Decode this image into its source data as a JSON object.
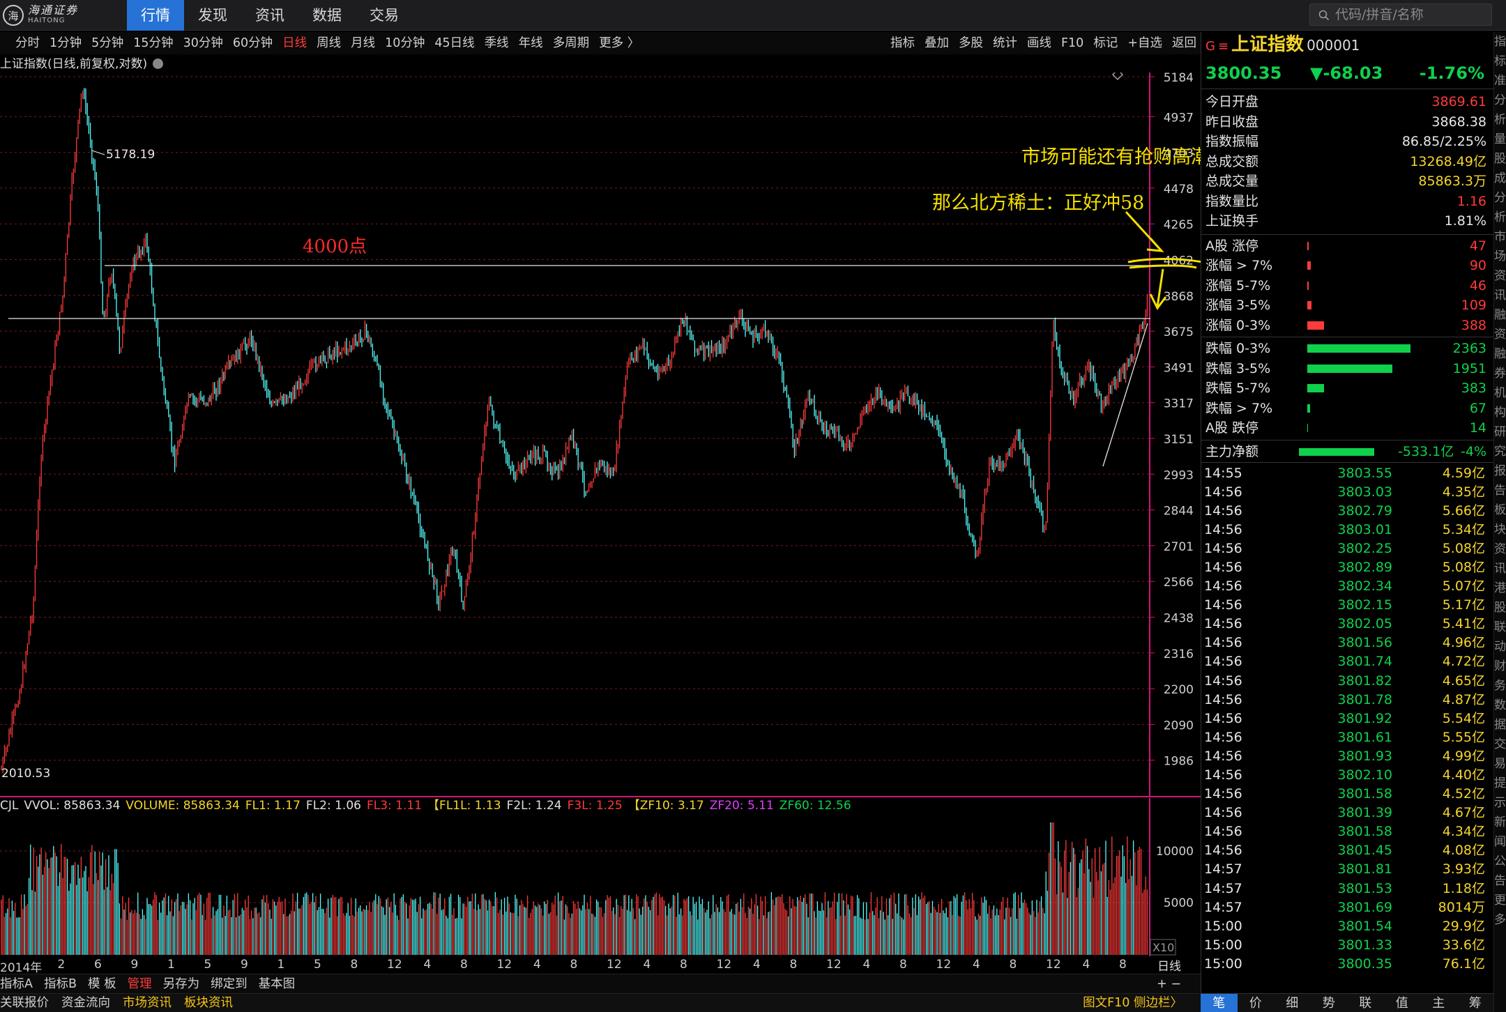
{
  "app": {
    "logo_cn": "海通证券",
    "logo_en": "HAITONG",
    "logo_mark": "海"
  },
  "nav": [
    {
      "label": "行情",
      "active": true
    },
    {
      "label": "发现"
    },
    {
      "label": "资讯"
    },
    {
      "label": "数据"
    },
    {
      "label": "交易"
    }
  ],
  "search": {
    "placeholder": "代码/拼音/名称"
  },
  "periods": [
    "分时",
    "1分钟",
    "5分钟",
    "15分钟",
    "30分钟",
    "60分钟",
    "日线",
    "周线",
    "月线",
    "10分钟",
    "45日线",
    "季线",
    "年线",
    "多周期",
    "更多 〉"
  ],
  "period_active": "日线",
  "tools": [
    "指标",
    "叠加",
    "多股",
    "统计",
    "画线",
    "F10",
    "标记",
    "+自选",
    "返回"
  ],
  "chart": {
    "title": "上证指数(日线,前复权,对数)",
    "y_ticks": [
      "5184",
      "4937",
      "4703",
      "4478",
      "4265",
      "4062",
      "3868",
      "3675",
      "3491",
      "3317",
      "3151",
      "2993",
      "2844",
      "2701",
      "2566",
      "2438",
      "2316",
      "2200",
      "2090",
      "1986"
    ],
    "high_label": "5178.19",
    "low_label": "2010.53",
    "annotation_4000": "4000点",
    "annotation_1": "市场可能还有抢购高潮",
    "annotation_2": "那么北方稀土：正好冲58",
    "colors": {
      "up": "#ff3b3b",
      "down": "#54ffff",
      "grid": "#7a1a1a",
      "annot_red": "#ff2a2a",
      "annot_yellow": "#f5e000"
    }
  },
  "volume": {
    "indicators": [
      {
        "text": "CJL",
        "color": "#e0e0e0"
      },
      {
        "text": "VVOL: 85863.34",
        "color": "#e0e0e0"
      },
      {
        "text": "VOLUME: 85863.34",
        "color": "#f5d52b"
      },
      {
        "text": "FL1: 1.17",
        "color": "#f5d52b"
      },
      {
        "text": "FL2: 1.06",
        "color": "#e0e0e0"
      },
      {
        "text": "FL3: 1.11",
        "color": "#ff3b3b"
      },
      {
        "text": "【FL1L: 1.13",
        "color": "#f5d52b"
      },
      {
        "text": "F2L: 1.24",
        "color": "#e0e0e0"
      },
      {
        "text": "F3L: 1.25",
        "color": "#ff3b3b"
      },
      {
        "text": "【ZF10: 3.17",
        "color": "#f5d52b"
      },
      {
        "text": "ZF20: 5.11",
        "color": "#e040fb"
      },
      {
        "text": "ZF60: 12.56",
        "color": "#0fd14c"
      }
    ],
    "y_ticks": [
      "10000",
      "5000"
    ],
    "unit_label": "X10"
  },
  "xaxis": [
    "2014年",
    "2",
    "6",
    "9",
    "1",
    "5",
    "9",
    "1",
    "5",
    "8",
    "12",
    "4",
    "8",
    "12",
    "4",
    "8",
    "12",
    "4",
    "8",
    "12",
    "4",
    "8",
    "12",
    "4",
    "8",
    "12",
    "4",
    "8",
    "12",
    "4",
    "8"
  ],
  "xaxis_tab": "日线",
  "bottom_tabs": [
    "指标A",
    "指标B",
    "模 板",
    "管理",
    "另存为",
    "绑定到",
    "基本图"
  ],
  "bottom_tab_active": "管理",
  "bottom_plusminus": "+  −",
  "bottom_links": [
    {
      "label": "关联报价",
      "hl": false
    },
    {
      "label": "资金流向",
      "hl": false
    },
    {
      "label": "市场资讯",
      "hl": true
    },
    {
      "label": "板块资讯",
      "hl": true
    }
  ],
  "bottom_right": "图文F10  侧边栏〉",
  "quote": {
    "g": "G",
    "eq": "≡",
    "name": "上证指数",
    "code": "000001",
    "price": "3800.35",
    "change": "▼-68.03",
    "pct": "-1.76%"
  },
  "stats": [
    {
      "k": "今日开盘",
      "v": "3869.61",
      "c": "#ff3b3b"
    },
    {
      "k": "昨日收盘",
      "v": "3868.38",
      "c": "#e8e8e8"
    },
    {
      "k": "指数振幅",
      "v": "86.85/2.25%",
      "c": "#e8e8e8"
    },
    {
      "k": "总成交额",
      "v": "13268.49亿",
      "c": "#f5d52b"
    },
    {
      "k": "总成交量",
      "v": "85863.3万",
      "c": "#f5d52b"
    },
    {
      "k": "指数量比",
      "v": "1.16",
      "c": "#ff3b3b"
    },
    {
      "k": "上证换手",
      "v": "1.81%",
      "c": "#e8e8e8"
    }
  ],
  "breadth_up": [
    {
      "k": "A股 涨停",
      "v": "47",
      "w": 2,
      "c": "#ff3b3b"
    },
    {
      "k": "涨幅 > 7%",
      "v": "90",
      "w": 5,
      "c": "#ff3b3b"
    },
    {
      "k": "涨幅 5-7%",
      "v": "46",
      "w": 2,
      "c": "#ff3b3b"
    },
    {
      "k": "涨幅 3-5%",
      "v": "109",
      "w": 6,
      "c": "#ff3b3b"
    },
    {
      "k": "涨幅 0-3%",
      "v": "388",
      "w": 24,
      "c": "#ff3b3b"
    }
  ],
  "breadth_down": [
    {
      "k": "跌幅 0-3%",
      "v": "2363",
      "w": 148,
      "c": "#0fd14c"
    },
    {
      "k": "跌幅 3-5%",
      "v": "1951",
      "w": 122,
      "c": "#0fd14c"
    },
    {
      "k": "跌幅 5-7%",
      "v": "383",
      "w": 24,
      "c": "#0fd14c"
    },
    {
      "k": "跌幅 > 7%",
      "v": "67",
      "w": 4,
      "c": "#0fd14c"
    },
    {
      "k": "A股 跌停",
      "v": "14",
      "w": 1,
      "c": "#0fd14c"
    }
  ],
  "flow": {
    "k": "主力净额",
    "v": "-533.1亿",
    "pct": "-4%"
  },
  "ticks": [
    {
      "t": "14:55",
      "p": "3803.55",
      "v": "4.59亿"
    },
    {
      "t": "14:56",
      "p": "3803.03",
      "v": "4.35亿"
    },
    {
      "t": "14:56",
      "p": "3802.79",
      "v": "5.66亿"
    },
    {
      "t": "14:56",
      "p": "3803.01",
      "v": "5.34亿"
    },
    {
      "t": "14:56",
      "p": "3802.25",
      "v": "5.08亿"
    },
    {
      "t": "14:56",
      "p": "3802.89",
      "v": "5.08亿"
    },
    {
      "t": "14:56",
      "p": "3802.34",
      "v": "5.07亿"
    },
    {
      "t": "14:56",
      "p": "3802.15",
      "v": "5.17亿"
    },
    {
      "t": "14:56",
      "p": "3802.05",
      "v": "5.41亿"
    },
    {
      "t": "14:56",
      "p": "3801.56",
      "v": "4.96亿"
    },
    {
      "t": "14:56",
      "p": "3801.74",
      "v": "4.72亿"
    },
    {
      "t": "14:56",
      "p": "3801.82",
      "v": "4.65亿"
    },
    {
      "t": "14:56",
      "p": "3801.78",
      "v": "4.87亿"
    },
    {
      "t": "14:56",
      "p": "3801.92",
      "v": "5.54亿"
    },
    {
      "t": "14:56",
      "p": "3801.61",
      "v": "5.55亿"
    },
    {
      "t": "14:56",
      "p": "3801.93",
      "v": "4.99亿"
    },
    {
      "t": "14:56",
      "p": "3802.10",
      "v": "4.40亿"
    },
    {
      "t": "14:56",
      "p": "3801.58",
      "v": "4.52亿"
    },
    {
      "t": "14:56",
      "p": "3801.39",
      "v": "4.67亿"
    },
    {
      "t": "14:56",
      "p": "3801.58",
      "v": "4.34亿"
    },
    {
      "t": "14:56",
      "p": "3801.45",
      "v": "4.08亿"
    },
    {
      "t": "14:57",
      "p": "3801.81",
      "v": "3.93亿"
    },
    {
      "t": "14:57",
      "p": "3801.53",
      "v": "1.18亿"
    },
    {
      "t": "14:57",
      "p": "3801.69",
      "v": "8014万"
    },
    {
      "t": "15:00",
      "p": "3801.54",
      "v": "29.9亿"
    },
    {
      "t": "15:00",
      "p": "3801.33",
      "v": "33.6亿"
    },
    {
      "t": "15:00",
      "p": "3800.35",
      "v": "76.1亿"
    }
  ],
  "rp_tabs": [
    "笔",
    "价",
    "细",
    "势",
    "联",
    "值",
    "主",
    "筹"
  ],
  "rp_tab_active": "笔",
  "edge_labels": [
    "指",
    "标",
    "准",
    "分",
    "析",
    "量",
    "股",
    "成",
    "分",
    "析",
    "市",
    "场",
    "资",
    "讯",
    "融",
    "资",
    "融",
    "券",
    "机",
    "构",
    "研",
    "究",
    "报",
    "告",
    "板",
    "块",
    "资",
    "讯",
    "港",
    "股",
    "联",
    "动",
    "财",
    "务",
    "数",
    "据",
    "交",
    "易",
    "提",
    "示",
    "新",
    "闻",
    "公",
    "告",
    "更",
    "多"
  ]
}
